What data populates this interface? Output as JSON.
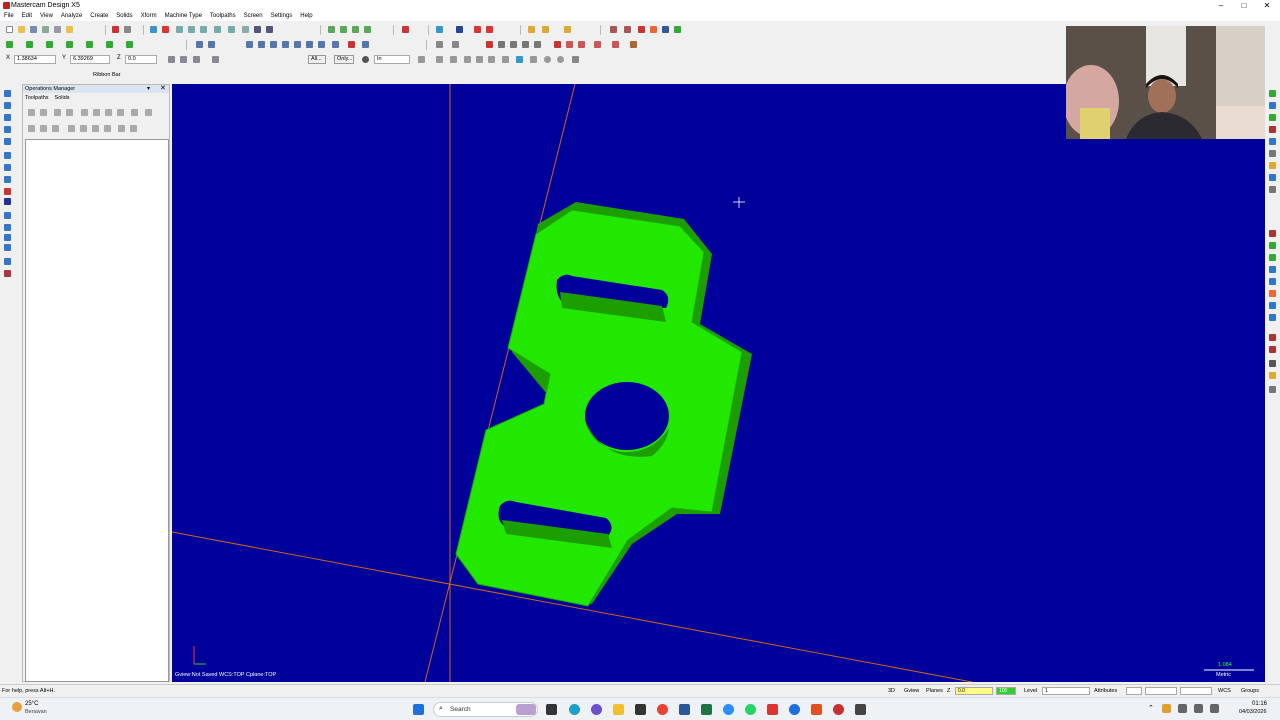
{
  "window": {
    "title": "Mastercam Design X5",
    "controls": [
      "–",
      "□",
      "✕"
    ]
  },
  "menu": [
    "File",
    "Edit",
    "View",
    "Analyze",
    "Create",
    "Solids",
    "Xform",
    "Machine Type",
    "Toolpaths",
    "Screen",
    "Settings",
    "Help"
  ],
  "coords": {
    "x_label": "X",
    "x_value": "1.38634",
    "y_label": "Y",
    "y_value": "6.39269",
    "z_label": "Z",
    "z_value": "0.0",
    "all_btn": "All...",
    "only_btn": "Only...",
    "units": "In"
  },
  "ribbon_label": "Ribbon Bar",
  "ops_manager": {
    "title": "Operations Manager",
    "tabs": [
      "Toolpaths",
      "Solids"
    ]
  },
  "viewport": {
    "gview_status": "Gview:Not Saved   WCS:TOP   Cplane:TOP",
    "scale_value": "1.084",
    "scale_unit": "Metric"
  },
  "statusbar": {
    "help": "For help, press Alt+H.",
    "mode": "3D",
    "gview": "Gview",
    "planes": "Planes",
    "z_label": "Z",
    "z_value": "0.0",
    "color_value": "100",
    "level_label": "Level",
    "level_value": "1",
    "attributes": "Attributes",
    "wcs": "WCS",
    "groups": "Groups"
  },
  "taskbar": {
    "weather_temp": "25°C",
    "weather_desc": "Berawan",
    "search": "Search",
    "time": "01:16",
    "date": "04/03/2026"
  },
  "colors": {
    "viewport_bg": "#00009b",
    "part": "#22e800",
    "axis": "#c8641e"
  }
}
